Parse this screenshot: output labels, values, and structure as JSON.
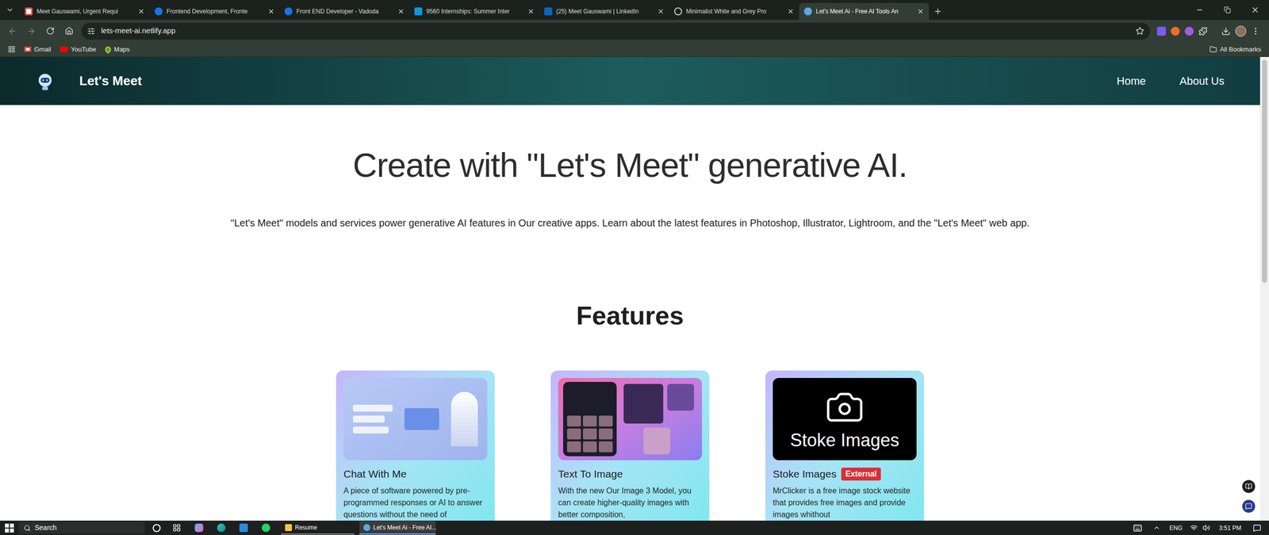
{
  "browser": {
    "tabs": [
      {
        "label": "Meet Gauswami, Urgent Requi",
        "kind": "gmail",
        "selected": false
      },
      {
        "label": "Frontend Development, Fronte",
        "kind": "internshala",
        "selected": false
      },
      {
        "label": "Front END Developer - Vadoda",
        "kind": "internshala",
        "selected": false
      },
      {
        "label": "9560 Internships: Summer Inter",
        "kind": "is",
        "selected": false
      },
      {
        "label": "(25) Meet Gauswami | LinkedIn",
        "kind": "linkedin",
        "selected": false
      },
      {
        "label": "Minimalist White and Grey Pro",
        "kind": "web",
        "selected": false
      },
      {
        "label": "Let's Meet Ai - Free AI Tools An",
        "kind": "site",
        "selected": true
      }
    ],
    "address": "lets-meet-ai.netlify.app",
    "bookmarks": [
      {
        "label": "Gmail",
        "kind": "gmail"
      },
      {
        "label": "YouTube",
        "kind": "youtube"
      },
      {
        "label": "Maps",
        "kind": "maps"
      }
    ],
    "all_bookmarks": "All Bookmarks"
  },
  "site": {
    "brand": "Let's Meet",
    "nav": [
      "Home",
      "About Us"
    ],
    "hero": {
      "title": "Create with \"Let's Meet\" generative AI.",
      "subtitle": "\"Let's Meet\" models and services power generative AI features in Our creative apps. Learn about the latest features in Photoshop, Illustrator, Lightroom, and the \"Let's Meet\" web app."
    },
    "features_heading": "Features",
    "cards": [
      {
        "kind": "chat",
        "title": "Chat With Me",
        "description": "A piece of software powered by pre-programmed responses or AI to answer questions without the need of"
      },
      {
        "kind": "text-to-image",
        "title": "Text To Image",
        "description": "With the new Our Image 3 Model, you can create higher-quality images with better composition,"
      },
      {
        "kind": "stock",
        "title": "Stoke Images",
        "badge": "External",
        "image_text": "Stoke Images",
        "description": "MrClicker is a free image stock website that provides free images and provide images whithout"
      }
    ]
  },
  "taskbar": {
    "search": "Search",
    "apps": [
      {
        "label": "Resume",
        "selected": false
      },
      {
        "label": "Let's Meet Ai - Free AI...",
        "selected": true
      }
    ],
    "language": "ENG",
    "time": "3:51 PM"
  }
}
